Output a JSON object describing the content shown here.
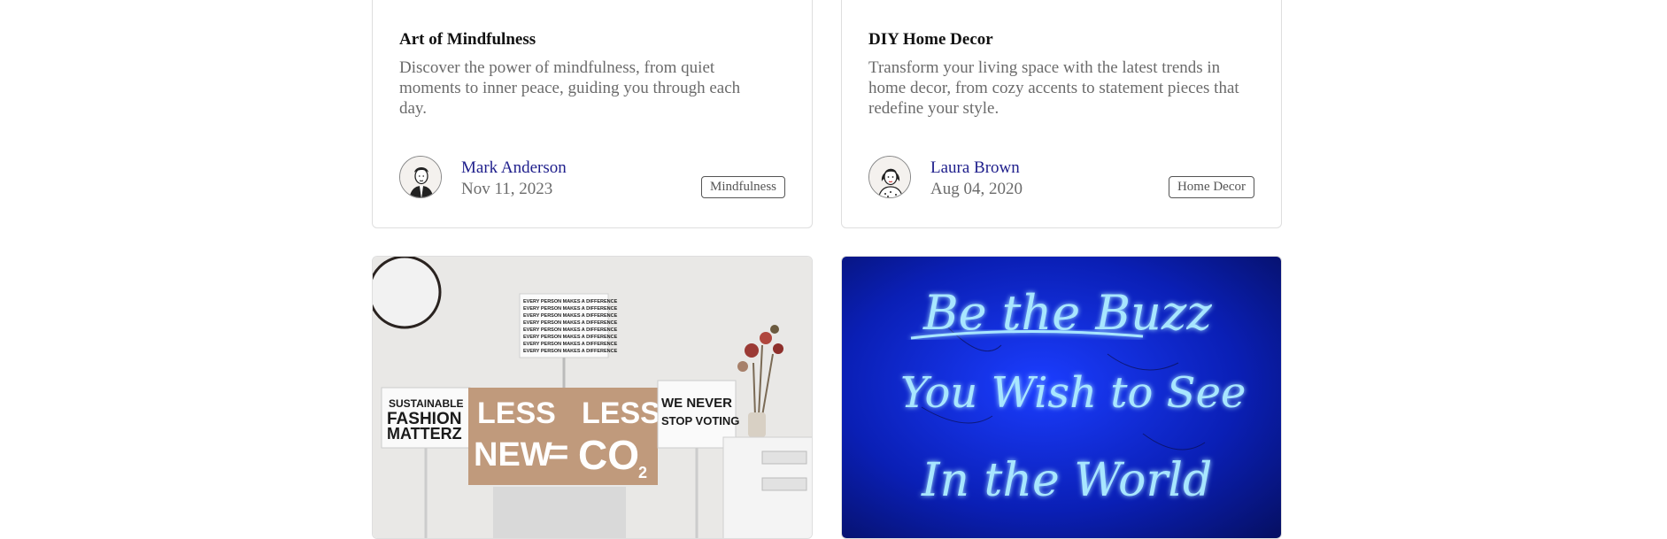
{
  "cards": [
    {
      "title": "Art of Mindfulness",
      "description": "Discover the power of mindfulness, from quiet moments to inner peace, guiding you through each day.",
      "author": "Mark Anderson",
      "date": "Nov 11, 2023",
      "tag": "Mindfulness"
    },
    {
      "title": "DIY Home Decor",
      "description": "Transform your living space with the latest trends in home decor, from cozy accents to statement pieces that redefine your style.",
      "author": "Laura Brown",
      "date": "Aug 04, 2020",
      "tag": "Home Decor"
    }
  ],
  "image_cards": [
    {
      "sign_top": "EVERY PERSON MAKES A DIFFERENCE",
      "sign_left": [
        "SUSTAINABLE",
        "FASHION",
        "MATTERZ"
      ],
      "sign_center": [
        "LESS",
        "LESS",
        "NEW",
        "=",
        "CO",
        "2"
      ],
      "sign_right": [
        "WE NEVER",
        "STOP VOTING"
      ]
    },
    {
      "neon_lines": [
        "Be the Buzz",
        "You Wish to See",
        "In the World"
      ],
      "neon_color": "#7fd3ff"
    }
  ]
}
